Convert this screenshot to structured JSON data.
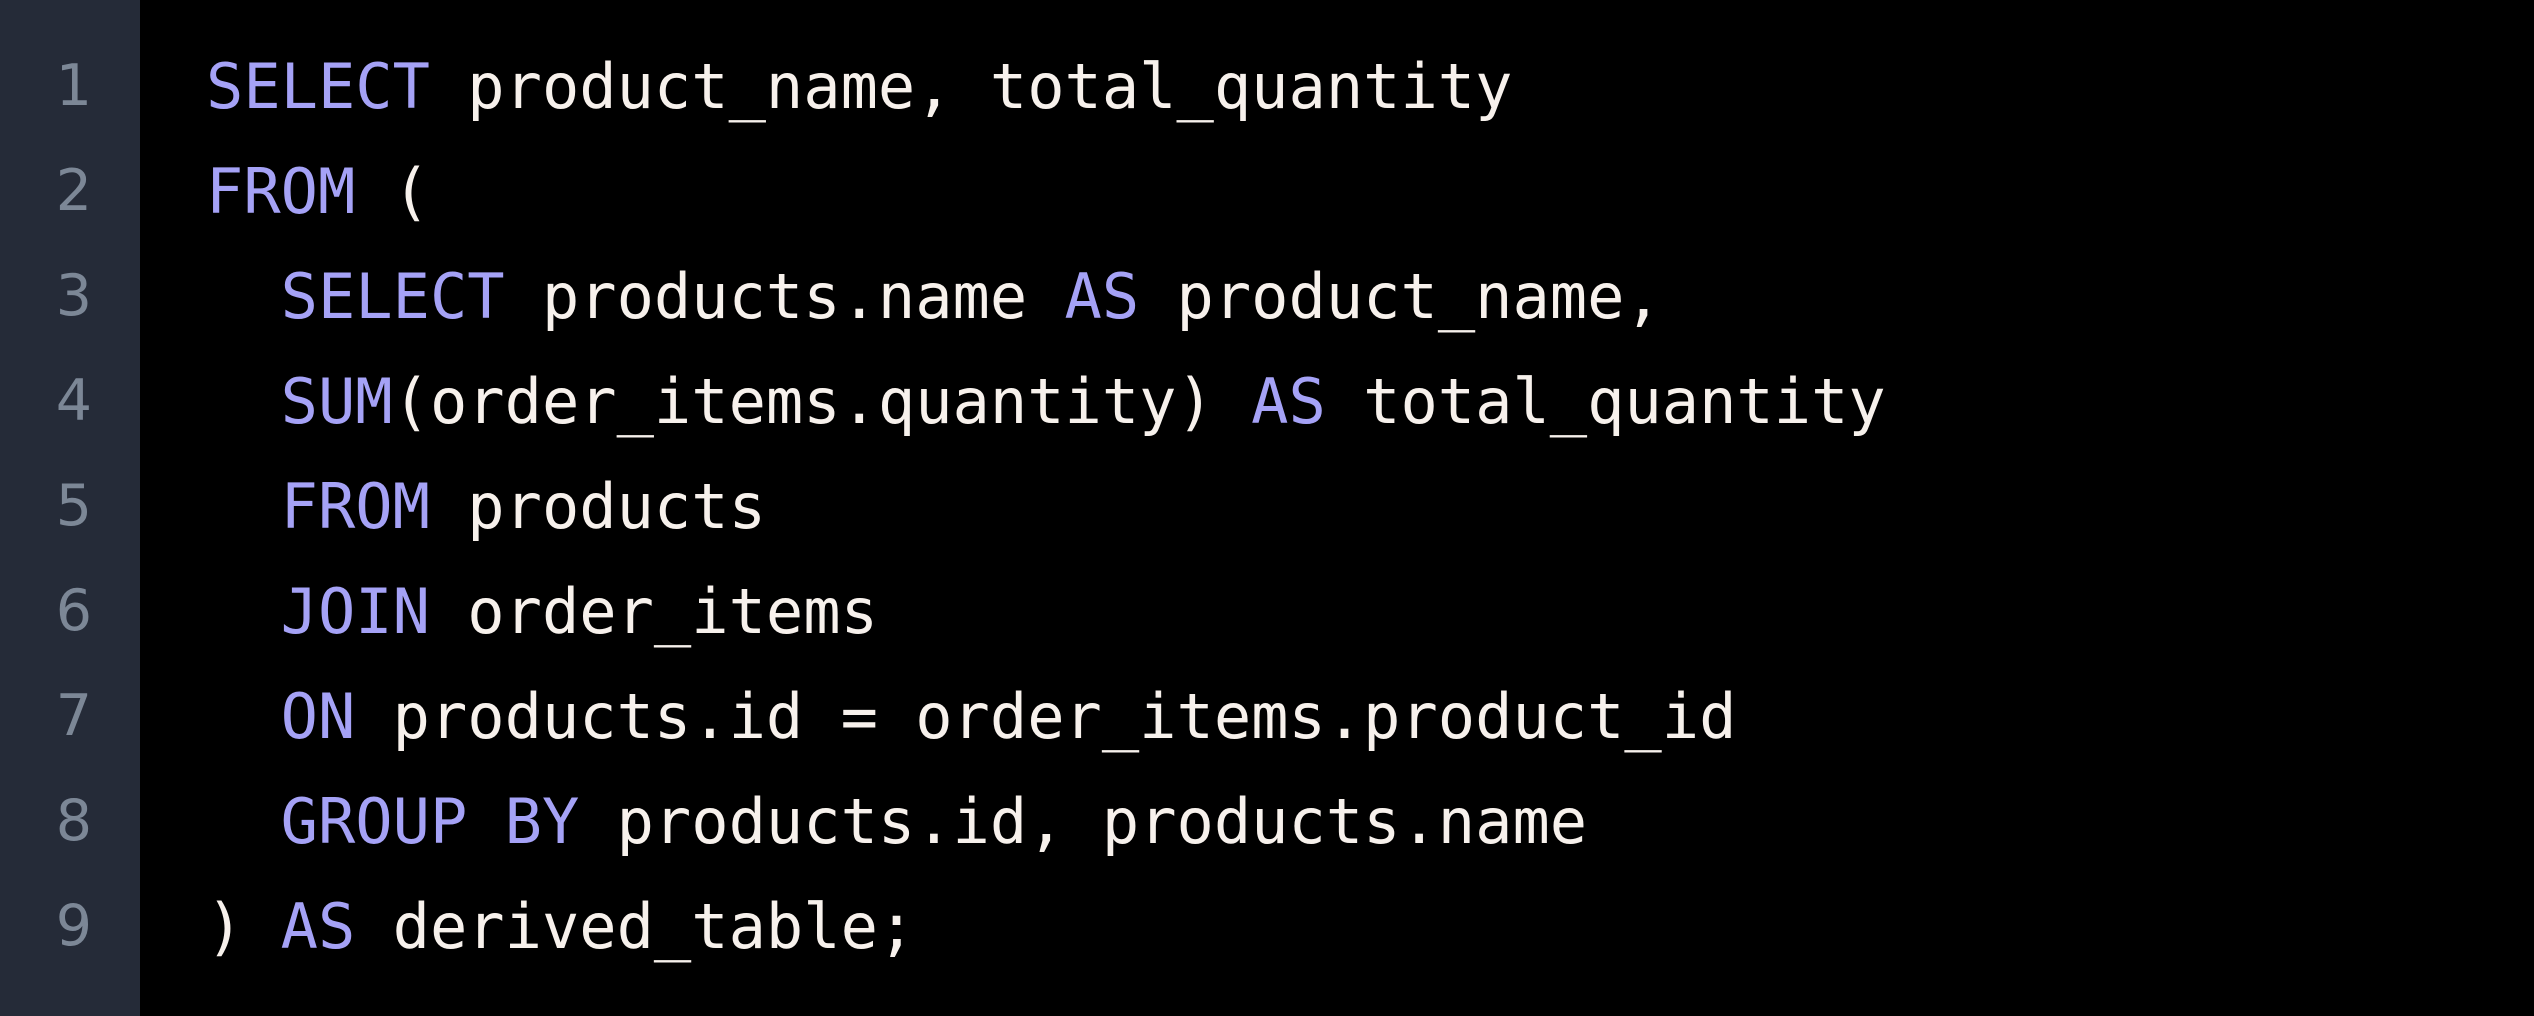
{
  "editor": {
    "language": "sql",
    "theme": {
      "background": "#000000",
      "gutter_background": "#252b38",
      "line_number_color": "#7c8796",
      "text_color": "#f7f1ec",
      "keyword_color": "#a5a2f6"
    },
    "line_count": 9,
    "gutter": {
      "line_numbers": [
        "1",
        "2",
        "3",
        "4",
        "5",
        "6",
        "7",
        "8",
        "9"
      ]
    },
    "lines": [
      {
        "number": "1",
        "indent": "",
        "text": "SELECT product_name, total_quantity",
        "tokens": [
          {
            "t": "SELECT",
            "k": "kw"
          },
          {
            "t": " product_name, total_quantity",
            "k": "txt"
          }
        ]
      },
      {
        "number": "2",
        "indent": "",
        "text": "FROM (",
        "tokens": [
          {
            "t": "FROM",
            "k": "kw"
          },
          {
            "t": " (",
            "k": "punc"
          }
        ]
      },
      {
        "number": "3",
        "indent": "  ",
        "text": "  SELECT products.name AS product_name,",
        "tokens": [
          {
            "t": "  ",
            "k": "txt"
          },
          {
            "t": "SELECT",
            "k": "kw"
          },
          {
            "t": " products.name ",
            "k": "txt"
          },
          {
            "t": "AS",
            "k": "kw"
          },
          {
            "t": " product_name,",
            "k": "txt"
          }
        ]
      },
      {
        "number": "4",
        "indent": "  ",
        "text": "  SUM(order_items.quantity) AS total_quantity",
        "tokens": [
          {
            "t": "  ",
            "k": "txt"
          },
          {
            "t": "SUM",
            "k": "kw"
          },
          {
            "t": "(order_items.quantity) ",
            "k": "txt"
          },
          {
            "t": "AS",
            "k": "kw"
          },
          {
            "t": " total_quantity",
            "k": "txt"
          }
        ]
      },
      {
        "number": "5",
        "indent": "  ",
        "text": "  FROM products",
        "tokens": [
          {
            "t": "  ",
            "k": "txt"
          },
          {
            "t": "FROM",
            "k": "kw"
          },
          {
            "t": " products",
            "k": "txt"
          }
        ]
      },
      {
        "number": "6",
        "indent": "  ",
        "text": "  JOIN order_items",
        "tokens": [
          {
            "t": "  ",
            "k": "txt"
          },
          {
            "t": "JOIN",
            "k": "kw"
          },
          {
            "t": " order_items",
            "k": "txt"
          }
        ]
      },
      {
        "number": "7",
        "indent": "  ",
        "text": "  ON products.id = order_items.product_id",
        "tokens": [
          {
            "t": "  ",
            "k": "txt"
          },
          {
            "t": "ON",
            "k": "kw"
          },
          {
            "t": " products.id = order_items.product_id",
            "k": "txt"
          }
        ]
      },
      {
        "number": "8",
        "indent": "  ",
        "text": "  GROUP BY products.id, products.name",
        "tokens": [
          {
            "t": "  ",
            "k": "txt"
          },
          {
            "t": "GROUP BY",
            "k": "kw"
          },
          {
            "t": " products.id, products.name",
            "k": "txt"
          }
        ]
      },
      {
        "number": "9",
        "indent": "",
        "text": ") AS derived_table;",
        "tokens": [
          {
            "t": ") ",
            "k": "punc"
          },
          {
            "t": "AS",
            "k": "kw"
          },
          {
            "t": " derived_table;",
            "k": "txt"
          }
        ]
      }
    ]
  }
}
